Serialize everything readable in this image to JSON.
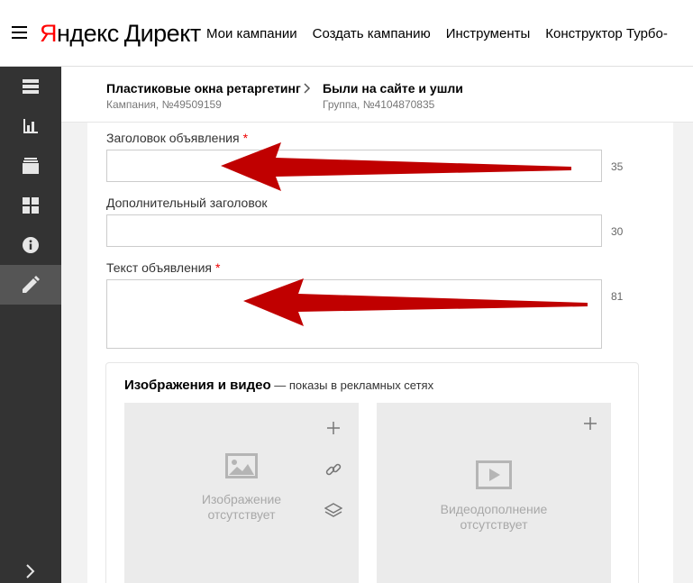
{
  "header": {
    "logo_ya": "Я",
    "logo_rest": "ндекс",
    "logo_direct": "Директ",
    "nav": [
      "Мои кампании",
      "Создать кампанию",
      "Инструменты",
      "Конструктор Турбо-"
    ]
  },
  "sidebar": {
    "items": [
      "list-icon",
      "chart-icon",
      "archive-icon",
      "grid-icon",
      "info-icon",
      "pencil-icon"
    ],
    "active": "pencil-icon",
    "expand": "chevron-right-icon"
  },
  "breadcrumb": {
    "campaign_title": "Пластиковые окна ретаргетинг",
    "campaign_sub": "Кампания, №49509159",
    "group_title": "Были на сайте и ушли",
    "group_sub": "Группа, №4104870835",
    "separator": ">"
  },
  "form": {
    "headline_label": "Заголовок объявления",
    "headline_required": "*",
    "headline_value": "",
    "headline_counter": "35",
    "extra_label": "Дополнительный заголовок",
    "extra_value": "",
    "extra_counter": "30",
    "text_label": "Текст объявления",
    "text_required": "*",
    "text_value": "",
    "text_counter": "81"
  },
  "media": {
    "title": "Изображения и видео",
    "subtitle": " — показы в рекламных сетях",
    "image_empty_line1": "Изображение",
    "image_empty_line2": "отсутствует",
    "video_empty_line1": "Видеодополнение",
    "video_empty_line2": "отсутствует",
    "add_symbol": "+"
  },
  "colors": {
    "accent_red": "#f00",
    "annotation_arrow": "#c00",
    "sidebar_bg": "#333333"
  }
}
